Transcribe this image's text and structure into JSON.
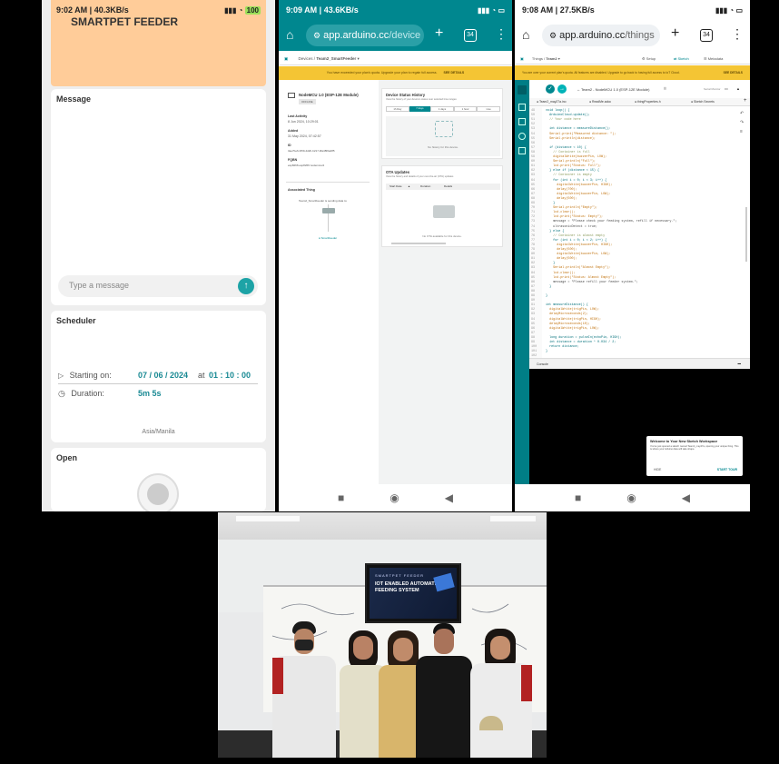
{
  "panel1": {
    "status": {
      "time": "9:02 AM | 40.3KB/s",
      "battery": "100"
    },
    "header_title": "SMARTPET FEEDER",
    "message_card": {
      "title": "Message",
      "input_placeholder": "Type a message"
    },
    "scheduler": {
      "title": "Scheduler",
      "starting_label": "Starting on:",
      "start_date": "07 / 06 / 2024",
      "at_text": "at",
      "start_time": "01 : 10 : 00",
      "duration_label": "Duration:",
      "duration_value": "5m 5s",
      "timezone": "Asia/Manila"
    },
    "open_card": {
      "title": "Open"
    }
  },
  "panel2": {
    "status": {
      "time": "9:09 AM | 43.6KB/s"
    },
    "url_host": "app.arduino.cc",
    "url_path": "/device",
    "tab_count": "34",
    "breadcrumb": {
      "root": "Devices",
      "current": "Team2_SmartFeeder"
    },
    "banner": {
      "text": "You have exceeded your plan's quota. Upgrade your plan to regain full access.",
      "action": "SEE DETAILS"
    },
    "device": {
      "name": "NodeMCU 1.0 (ESP-12E Module)",
      "badge": "OFFLINE",
      "last_activity_label": "Last Activity",
      "last_activity_value": "8 Jun 2024, 10:29:01",
      "added_label": "Added",
      "added_value": "31 May 2024, 07:42:57",
      "id_label": "ID",
      "id_value": "3ae7be6-f259-4d2b-b217-9fa48f0a285",
      "fqbn_label": "FQBN",
      "fqbn_value": "esp8266:esp8266:nodemcuv2",
      "assoc_label": "Associated Thing",
      "assoc_text": "Team2_SmartFeeder is sending data to:",
      "assoc_node": "SmartFeeder"
    },
    "status_history": {
      "title": "Device Status History",
      "subtitle": "View the history of your device's status over selected time ranges",
      "tabs": [
        "1h Day",
        "7 days",
        "1 days",
        "1 hour",
        "Live"
      ],
      "empty": "No history for this device."
    },
    "ota": {
      "title": "OTA Updates",
      "subtitle": "View the history and details of your over-the-air (OTA) updates",
      "cols": [
        "Start Date",
        "Duration",
        "Details"
      ],
      "empty": "No OTA available for this device."
    }
  },
  "panel3": {
    "status": {
      "time": "9:08 AM | 27.5KB/s"
    },
    "url_host": "app.arduino.cc",
    "url_path": "/things",
    "tab_count": "34",
    "breadcrumb": {
      "root": "Things",
      "current": "Team2"
    },
    "top_tabs": [
      "Setup",
      "Sketch",
      "Metadata"
    ],
    "banner": {
      "text": "You are over your current plan's quota. All features are disabled. Upgrade to go back to having full access to IoT Cloud.",
      "action": "SEE DETAILS"
    },
    "board": "Team2 - NodeMCU 1.0 (ESP-12E Module)",
    "serial_label": "Serial Monitor",
    "file_tabs": [
      "Team2_may27a.ino",
      "ReadMe.adoc",
      "thingProperties.h",
      "Sketch Secrets"
    ],
    "line_numbers": [
      "49",
      "50",
      "51",
      "52",
      "53",
      "54",
      "55",
      "56",
      "57",
      "58",
      "59",
      "60",
      "61",
      "62",
      "63",
      "64",
      "65",
      "66",
      "67",
      "68",
      "69",
      "70",
      "71",
      "72",
      "73",
      "74",
      "75",
      "76",
      "77",
      "78",
      "79",
      "80",
      "81",
      "82",
      "83",
      "84",
      "85",
      "86",
      "87",
      "88",
      "89",
      "90",
      "91",
      "92",
      "93",
      "94",
      "95",
      "96",
      "97",
      "98",
      "99",
      "100",
      "101",
      "102"
    ],
    "code_lines": [
      "void loop() {",
      "  ArduinoCloud.update();",
      "  // Your code here",
      "",
      "  int distance = measureDistance();",
      "  Serial.print(\"Measured distance: \");",
      "  Serial.println(distance);",
      "",
      "  if (distance < 10) {",
      "    // Container is full",
      "    digitalWrite(buzzerPin, LOW);",
      "    Serial.println(\"Full\");",
      "    lcd.print(\"Status: Full\");",
      "  } else if (distance < 15) {",
      "    // Container is empty",
      "    for (int i = 0; i < 3; i++) {",
      "      digitalWrite(buzzerPin, HIGH);",
      "      delay(700);",
      "      digitalWrite(buzzerPin, LOW);",
      "      delay(500);",
      "    }",
      "    Serial.println(\"Empty\");",
      "    lcd.clear();",
      "    lcd.print(\"Status: Empty\");",
      "    message = \"Please check your feeding system, refill if necessary.\";",
      "    ultrasonicDetect = true;",
      "  } else {",
      "    // Container is almost empty",
      "    for (int i = 0; i < 2; i++) {",
      "      digitalWrite(buzzerPin, HIGH);",
      "      delay(500);",
      "      digitalWrite(buzzerPin, LOW);",
      "      delay(500);",
      "    }",
      "    Serial.println(\"Almost Empty\");",
      "    lcd.clear();",
      "    lcd.print(\"Status: Almost Empty\");",
      "    message = \"Please refill your feeder system.\";",
      "  }",
      "",
      "}",
      "",
      "int measureDistance() {",
      "  digitalWrite(trigPin, LOW);",
      "  delayMicroseconds(2);",
      "  digitalWrite(trigPin, HIGH);",
      "  delayMicroseconds(10);",
      "  digitalWrite(trigPin, LOW);",
      "",
      "  long duration = pulseIn(echoPin, HIGH);",
      "  int distance = duration * 0.034 / 2;",
      "  return distance;",
      "}",
      ""
    ],
    "console_label": "Console",
    "welcome": {
      "title": "Welcome to Your New Sketch Workspace",
      "body": "You've just opened a sketch named Team2_may27a, opening your unique thing. This is where your Arduino data will take shape.",
      "hide": "HIDE",
      "start": "START TOUR"
    }
  },
  "photo": {
    "screen_small": "SMARTPET FEEDER",
    "screen_title_1": "IOT ENABLED AUTOMATED",
    "screen_title_2": "FEEDING SYSTEM"
  },
  "colors": {
    "peach": "#ffcc99",
    "teal": "#00878f",
    "banner_yellow": "#f4c534",
    "teal_accent": "#1da3a6"
  }
}
